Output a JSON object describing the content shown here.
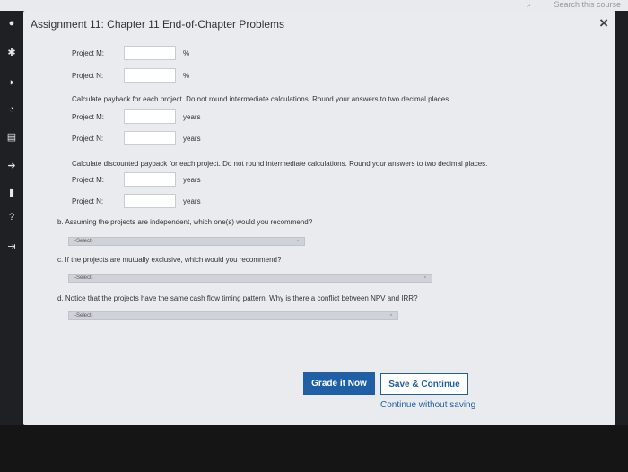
{
  "top_bar": {
    "search_text": "Search this course"
  },
  "dialog": {
    "title": "Assignment 11: Chapter 11 End-of-Chapter Problems",
    "close_symbol": "×"
  },
  "irr": {
    "project_m_label": "Project M:",
    "project_n_label": "Project N:",
    "unit": "%"
  },
  "payback": {
    "instruction": "Calculate payback for each project. Do not round intermediate calculations. Round your answers to two decimal places.",
    "project_m_label": "Project M:",
    "project_n_label": "Project N:",
    "unit": "years"
  },
  "discounted_payback": {
    "instruction": "Calculate discounted payback for each project. Do not round intermediate calculations. Round your answers to two decimal places.",
    "project_m_label": "Project M:",
    "project_n_label": "Project N:",
    "unit": "years"
  },
  "questions": {
    "b": {
      "text": "b. Assuming the projects are independent, which one(s) would you recommend?",
      "select_value": "-Select-"
    },
    "c": {
      "text": "c. If the projects are mutually exclusive, which would you recommend?",
      "select_value": "-Select-"
    },
    "d": {
      "text": "d. Notice that the projects have the same cash flow timing pattern. Why is there a conflict between NPV and IRR?",
      "select_value": "-Select-"
    }
  },
  "actions": {
    "grade_label": "Grade it Now",
    "save_label": "Save & Continue",
    "continue_link": "Continue without saving"
  }
}
